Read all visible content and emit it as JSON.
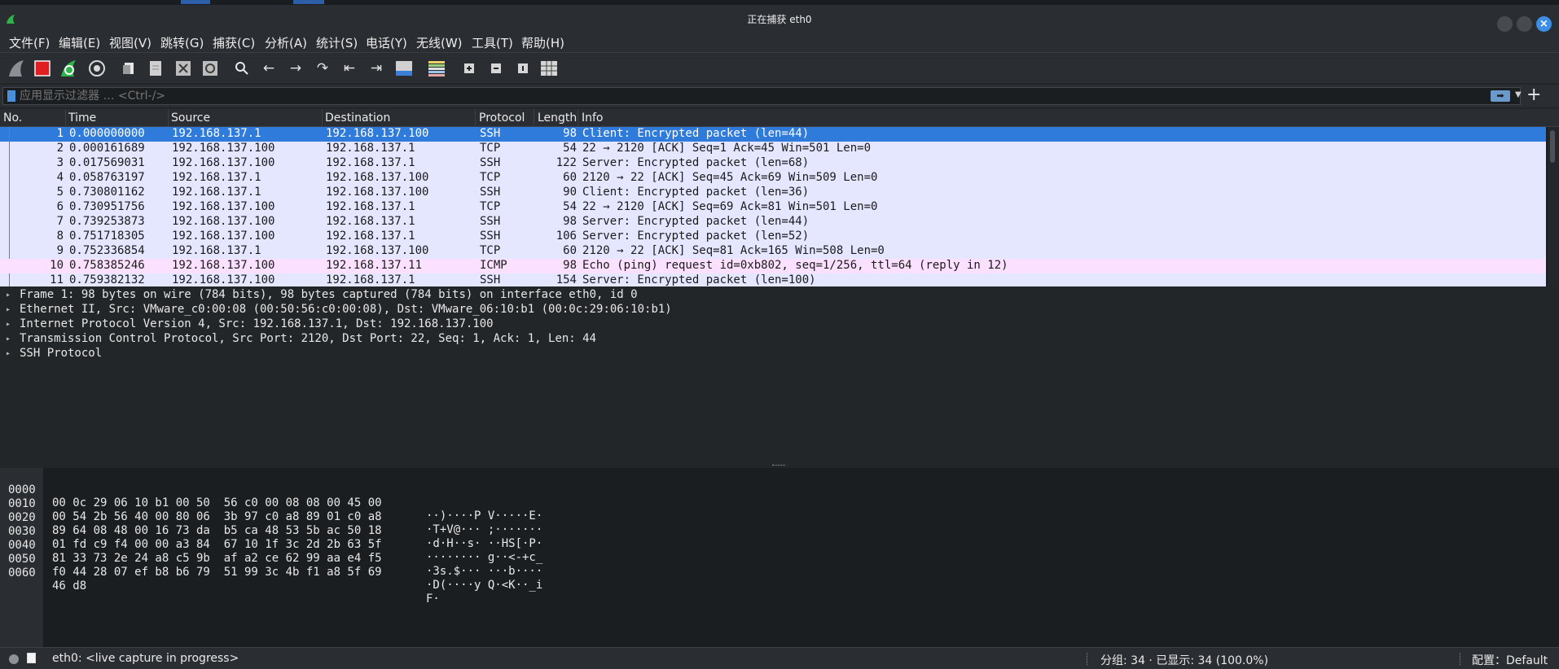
{
  "window": {
    "title": "正在捕获 eth0"
  },
  "menu": [
    {
      "label": "文件(F)"
    },
    {
      "label": "编辑(E)"
    },
    {
      "label": "视图(V)"
    },
    {
      "label": "跳转(G)"
    },
    {
      "label": "捕获(C)"
    },
    {
      "label": "分析(A)"
    },
    {
      "label": "统计(S)"
    },
    {
      "label": "电话(Y)"
    },
    {
      "label": "无线(W)"
    },
    {
      "label": "工具(T)"
    },
    {
      "label": "帮助(H)"
    }
  ],
  "toolbar": [
    {
      "icon": "shark-fin-start-icon"
    },
    {
      "icon": "stop-capture-icon"
    },
    {
      "icon": "restart-capture-icon"
    },
    {
      "icon": "capture-options-icon"
    },
    {
      "icon": "open-file-icon"
    },
    {
      "icon": "save-file-icon"
    },
    {
      "icon": "close-file-icon"
    },
    {
      "icon": "reload-file-icon"
    },
    {
      "icon": "find-packet-icon"
    },
    {
      "icon": "go-back-icon"
    },
    {
      "icon": "go-forward-icon"
    },
    {
      "icon": "go-to-packet-icon"
    },
    {
      "icon": "go-first-icon"
    },
    {
      "icon": "go-last-icon"
    },
    {
      "icon": "auto-scroll-icon"
    },
    {
      "icon": "colorize-icon"
    },
    {
      "icon": "zoom-in-icon"
    },
    {
      "icon": "zoom-out-icon"
    },
    {
      "icon": "normal-size-icon"
    },
    {
      "icon": "resize-columns-icon"
    }
  ],
  "filter": {
    "placeholder": "应用显示过滤器 … <Ctrl-/>"
  },
  "packet_list": {
    "columns": [
      "No.",
      "Time",
      "Source",
      "Destination",
      "Protocol",
      "Length",
      "Info"
    ],
    "rows": [
      {
        "no": "1",
        "time": "0.000000000",
        "src": "192.168.137.1",
        "dst": "192.168.137.100",
        "proto": "SSH",
        "len": "98",
        "info": "Client: Encrypted packet (len=44)",
        "state": "selected"
      },
      {
        "no": "2",
        "time": "0.000161689",
        "src": "192.168.137.100",
        "dst": "192.168.137.1",
        "proto": "TCP",
        "len": "54",
        "info": "22 → 2120 [ACK] Seq=1 Ack=45 Win=501 Len=0",
        "state": "normal"
      },
      {
        "no": "3",
        "time": "0.017569031",
        "src": "192.168.137.100",
        "dst": "192.168.137.1",
        "proto": "SSH",
        "len": "122",
        "info": "Server: Encrypted packet (len=68)",
        "state": "normal"
      },
      {
        "no": "4",
        "time": "0.058763197",
        "src": "192.168.137.1",
        "dst": "192.168.137.100",
        "proto": "TCP",
        "len": "60",
        "info": "2120 → 22 [ACK] Seq=45 Ack=69 Win=509 Len=0",
        "state": "normal"
      },
      {
        "no": "5",
        "time": "0.730801162",
        "src": "192.168.137.1",
        "dst": "192.168.137.100",
        "proto": "SSH",
        "len": "90",
        "info": "Client: Encrypted packet (len=36)",
        "state": "normal"
      },
      {
        "no": "6",
        "time": "0.730951756",
        "src": "192.168.137.100",
        "dst": "192.168.137.1",
        "proto": "TCP",
        "len": "54",
        "info": "22 → 2120 [ACK] Seq=69 Ack=81 Win=501 Len=0",
        "state": "normal"
      },
      {
        "no": "7",
        "time": "0.739253873",
        "src": "192.168.137.100",
        "dst": "192.168.137.1",
        "proto": "SSH",
        "len": "98",
        "info": "Server: Encrypted packet (len=44)",
        "state": "normal"
      },
      {
        "no": "8",
        "time": "0.751718305",
        "src": "192.168.137.100",
        "dst": "192.168.137.1",
        "proto": "SSH",
        "len": "106",
        "info": "Server: Encrypted packet (len=52)",
        "state": "normal"
      },
      {
        "no": "9",
        "time": "0.752336854",
        "src": "192.168.137.1",
        "dst": "192.168.137.100",
        "proto": "TCP",
        "len": "60",
        "info": "2120 → 22 [ACK] Seq=81 Ack=165 Win=508 Len=0",
        "state": "normal"
      },
      {
        "no": "10",
        "time": "0.758385246",
        "src": "192.168.137.100",
        "dst": "192.168.137.11",
        "proto": "ICMP",
        "len": "98",
        "info": "Echo (ping) request  id=0xb802, seq=1/256, ttl=64 (reply in 12)",
        "state": "icmp"
      },
      {
        "no": "11",
        "time": "0.759382132",
        "src": "192.168.137.100",
        "dst": "192.168.137.1",
        "proto": "SSH",
        "len": "154",
        "info": "Server: Encrypted packet (len=100)",
        "state": "normal"
      }
    ]
  },
  "details": [
    "Frame 1: 98 bytes on wire (784 bits), 98 bytes captured (784 bits) on interface eth0, id 0",
    "Ethernet II, Src: VMware_c0:00:08 (00:50:56:c0:00:08), Dst: VMware_06:10:b1 (00:0c:29:06:10:b1)",
    "Internet Protocol Version 4, Src: 192.168.137.1, Dst: 192.168.137.100",
    "Transmission Control Protocol, Src Port: 2120, Dst Port: 22, Seq: 1, Ack: 1, Len: 44",
    "SSH Protocol"
  ],
  "bytes": [
    {
      "offset": "0000",
      "hex": "00 0c 29 06 10 b1 00 50  56 c0 00 08 08 00 45 00",
      "ascii": "··)····P V·····E·"
    },
    {
      "offset": "0010",
      "hex": "00 54 2b 56 40 00 80 06  3b 97 c0 a8 89 01 c0 a8",
      "ascii": "·T+V@··· ;·······"
    },
    {
      "offset": "0020",
      "hex": "89 64 08 48 00 16 73 da  b5 ca 48 53 5b ac 50 18",
      "ascii": "·d·H··s· ··HS[·P·"
    },
    {
      "offset": "0030",
      "hex": "01 fd c9 f4 00 00 a3 84  67 10 1f 3c 2d 2b 63 5f",
      "ascii": "········ g··<-+c_"
    },
    {
      "offset": "0040",
      "hex": "81 33 73 2e 24 a8 c5 9b  af a2 ce 62 99 aa e4 f5",
      "ascii": "·3s.$··· ···b····"
    },
    {
      "offset": "0050",
      "hex": "f0 44 28 07 ef b8 b6 79  51 99 3c 4b f1 a8 5f 69",
      "ascii": "·D(····y Q·<K··_i"
    },
    {
      "offset": "0060",
      "hex": "46 d8",
      "ascii": "F·"
    }
  ],
  "status": {
    "capture": "eth0: <live capture in progress>",
    "packets": "分组: 34 · 已显示: 34 (100.0%)",
    "profile": "配置：Default"
  },
  "colors": {
    "selected_row": "#2f7bdc",
    "normal_row": "#e5e6ff",
    "icmp_row": "#fce0ff",
    "close_button": "#3d8ee6"
  }
}
